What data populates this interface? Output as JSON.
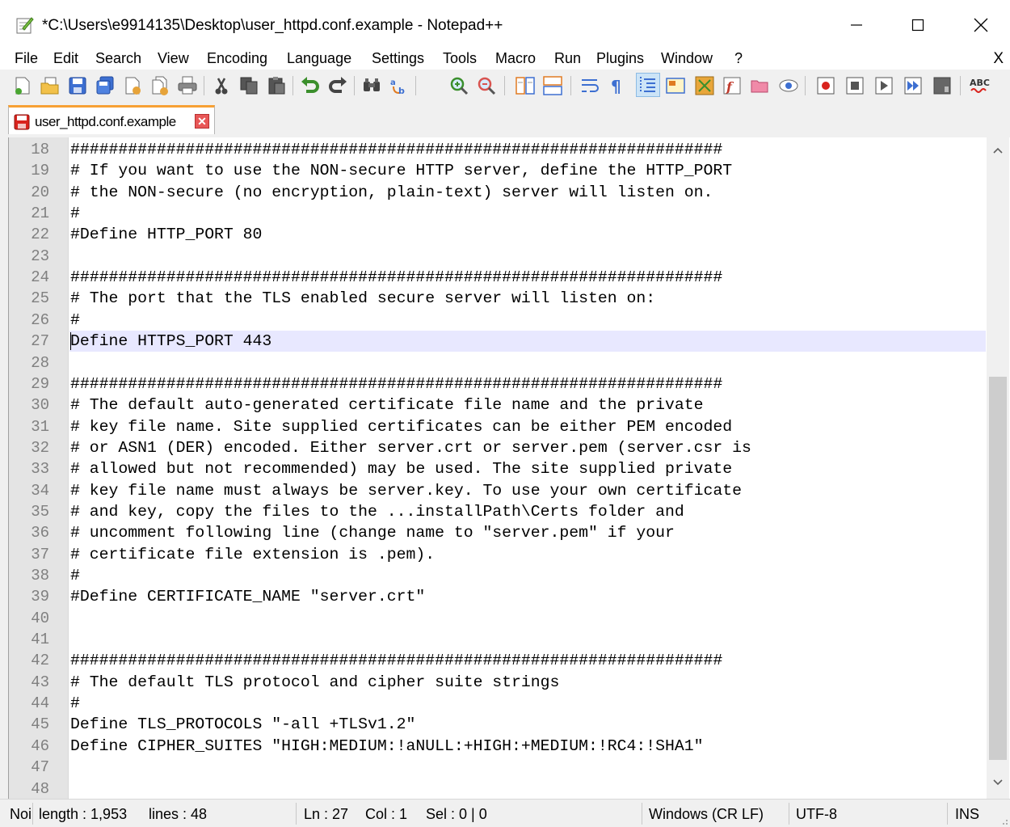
{
  "window": {
    "title": "*C:\\Users\\e9914135\\Desktop\\user_httpd.conf.example - Notepad++",
    "minimize_glyph": "—",
    "maximize_glyph": "☐",
    "close_glyph": "✕"
  },
  "menu": {
    "items": [
      "File",
      "Edit",
      "Search",
      "View",
      "Encoding",
      "Language",
      "Settings",
      "Tools",
      "Macro",
      "Run",
      "Plugins",
      "Window",
      "?"
    ],
    "close_doc": "X"
  },
  "toolbar": {
    "icons": [
      "new-file-icon",
      "open-file-icon",
      "save-icon",
      "save-all-icon",
      "close-icon",
      "close-all-icon",
      "print-icon",
      "cut-icon",
      "copy-icon",
      "paste-icon",
      "undo-icon",
      "redo-icon",
      "find-icon",
      "replace-icon",
      "zoom-in-icon",
      "zoom-out-icon",
      "sync-vertical-icon",
      "sync-horizontal-icon",
      "word-wrap-icon",
      "show-all-chars-icon",
      "indent-guide-icon",
      "user-language-icon",
      "document-map-icon",
      "function-list-icon",
      "folder-as-workspace-icon",
      "monitoring-icon",
      "record-macro-icon",
      "stop-record-icon",
      "playback-macro-icon",
      "run-macro-multiple-icon",
      "save-macro-icon",
      "spellcheck-icon"
    ],
    "spellcheck_label": "ABC"
  },
  "tab": {
    "label": "user_httpd.conf.example",
    "close_glyph": "✕"
  },
  "editor": {
    "current_line": 27,
    "lines": [
      {
        "no": "18",
        "text": "####################################################################"
      },
      {
        "no": "19",
        "text": "# If you want to use the NON-secure HTTP server, define the HTTP_PORT"
      },
      {
        "no": "20",
        "text": "# the NON-secure (no encryption, plain-text) server will listen on."
      },
      {
        "no": "21",
        "text": "#"
      },
      {
        "no": "22",
        "text": "#Define HTTP_PORT 80"
      },
      {
        "no": "23",
        "text": ""
      },
      {
        "no": "24",
        "text": "####################################################################"
      },
      {
        "no": "25",
        "text": "# The port that the TLS enabled secure server will listen on:"
      },
      {
        "no": "26",
        "text": "#"
      },
      {
        "no": "27",
        "text": "Define HTTPS_PORT 443"
      },
      {
        "no": "28",
        "text": ""
      },
      {
        "no": "29",
        "text": "####################################################################"
      },
      {
        "no": "30",
        "text": "# The default auto-generated certificate file name and the private"
      },
      {
        "no": "31",
        "text": "# key file name. Site supplied certificates can be either PEM encoded"
      },
      {
        "no": "32",
        "text": "# or ASN1 (DER) encoded. Either server.crt or server.pem (server.csr is"
      },
      {
        "no": "33",
        "text": "# allowed but not recommended) may be used. The site supplied private"
      },
      {
        "no": "34",
        "text": "# key file name must always be server.key. To use your own certificate"
      },
      {
        "no": "35",
        "text": "# and key, copy the files to the ...installPath\\Certs folder and"
      },
      {
        "no": "36",
        "text": "# uncomment following line (change name to \"server.pem\" if your"
      },
      {
        "no": "37",
        "text": "# certificate file extension is .pem)."
      },
      {
        "no": "38",
        "text": "#"
      },
      {
        "no": "39",
        "text": "#Define CERTIFICATE_NAME \"server.crt\""
      },
      {
        "no": "40",
        "text": ""
      },
      {
        "no": "41",
        "text": ""
      },
      {
        "no": "42",
        "text": "####################################################################"
      },
      {
        "no": "43",
        "text": "# The default TLS protocol and cipher suite strings"
      },
      {
        "no": "44",
        "text": "#"
      },
      {
        "no": "45",
        "text": "Define TLS_PROTOCOLS \"-all +TLSv1.2\""
      },
      {
        "no": "46",
        "text": "Define CIPHER_SUITES \"HIGH:MEDIUM:!aNULL:+HIGH:+MEDIUM:!RC4:!SHA1\""
      },
      {
        "no": "47",
        "text": ""
      },
      {
        "no": "48",
        "text": ""
      }
    ]
  },
  "status": {
    "doc_type": "Noi",
    "length": "length : 1,953",
    "lines": "lines : 48",
    "ln": "Ln : 27",
    "col": "Col : 1",
    "sel": "Sel : 0 | 0",
    "eol": "Windows (CR LF)",
    "encoding": "UTF-8",
    "mode": "INS"
  },
  "colors": {
    "tab_accent": "#f7a034",
    "current_line_bg": "#e8e8ff",
    "gutter_bg": "#e4e4e4",
    "line_number": "#808080"
  }
}
